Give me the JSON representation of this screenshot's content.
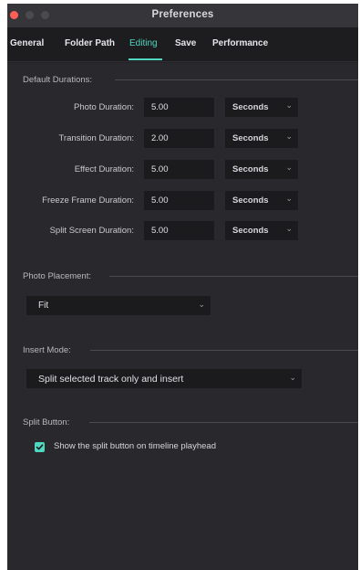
{
  "window": {
    "title": "Preferences"
  },
  "tabs": [
    {
      "label": "General"
    },
    {
      "label": "Folder Path"
    },
    {
      "label": "Editing"
    },
    {
      "label": "Save"
    },
    {
      "label": "Performance"
    }
  ],
  "active_tab": "Editing",
  "accent_color": "#4fd7c0",
  "default_durations": {
    "heading": "Default Durations:",
    "rows": [
      {
        "label": "Photo Duration:",
        "value": "5.00",
        "unit": "Seconds"
      },
      {
        "label": "Transition Duration:",
        "value": "2.00",
        "unit": "Seconds"
      },
      {
        "label": "Effect Duration:",
        "value": "5.00",
        "unit": "Seconds"
      },
      {
        "label": "Freeze Frame Duration:",
        "value": "5.00",
        "unit": "Seconds"
      },
      {
        "label": "Split Screen Duration:",
        "value": "5.00",
        "unit": "Seconds"
      }
    ]
  },
  "photo_placement": {
    "heading": "Photo Placement:",
    "value": "Fit"
  },
  "insert_mode": {
    "heading": "Insert Mode:",
    "value": "Split selected track only and insert"
  },
  "split_button": {
    "heading": "Split Button:",
    "checkbox_label": "Show the split button on timeline playhead",
    "checked": true
  }
}
